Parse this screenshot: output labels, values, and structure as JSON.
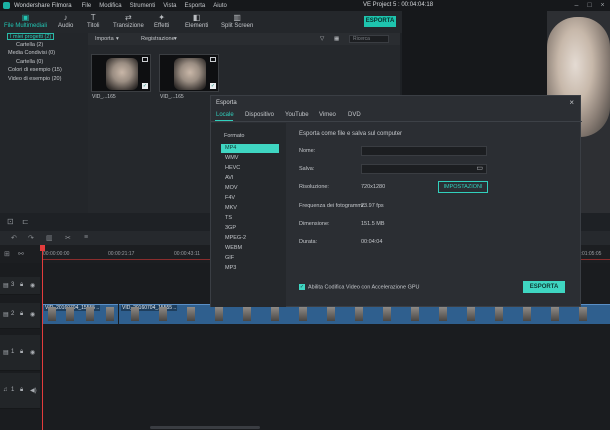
{
  "titlebar": {
    "app": "Wondershare Filmora",
    "menu": [
      "File",
      "Modifica",
      "Strumenti",
      "Vista",
      "Esporta",
      "Aiuto"
    ],
    "project": "VE Project 5 : 00:04:04:18"
  },
  "toolbar": {
    "tabs": [
      {
        "label": "File Multimediali",
        "icon": "folder-icon"
      },
      {
        "label": "Audio",
        "icon": "music-note-icon"
      },
      {
        "label": "Titoli",
        "icon": "text-icon"
      },
      {
        "label": "Transizione",
        "icon": "transition-icon"
      },
      {
        "label": "Effetti",
        "icon": "effects-icon"
      },
      {
        "label": "Elementi",
        "icon": "elements-icon"
      },
      {
        "label": "Split Screen",
        "icon": "split-screen-icon"
      }
    ],
    "export": "ESPORTA"
  },
  "sidebar": {
    "items": [
      "I miei progetti (2)",
      "Cartella (2)",
      "Media Condivisi (0)",
      "Cartella (0)",
      "Colori di esempio (15)",
      "Video di esempio (20)"
    ]
  },
  "media": {
    "import": "Importa",
    "record": "Registrazione",
    "search_placeholder": "Ricerca",
    "clips": [
      "VID_...165",
      "VID_...165"
    ]
  },
  "timeline": {
    "ticks": [
      "00:00:00:00",
      "00:00:21:17",
      "00:00:43:11",
      "00:01:05:05"
    ],
    "tracks": [
      "3",
      "2",
      "1",
      "1"
    ],
    "clip_labels": [
      "VID_20160704_15555 ..",
      "VID_20160704_15555 .."
    ]
  },
  "dialog": {
    "title": "Esporta",
    "tabs": [
      "Locale",
      "Dispositivo",
      "YouTube",
      "Vimeo",
      "DVD"
    ],
    "format_header": "Formato",
    "formats": [
      "MP4",
      "WMV",
      "HEVC",
      "AVI",
      "MOV",
      "F4V",
      "MKV",
      "TS",
      "3GP",
      "MPEG-2",
      "WEBM",
      "GIF",
      "MP3"
    ],
    "selected_format": "MP4",
    "heading": "Esporta come file e salva sul computer",
    "fields": {
      "name_label": "Nome:",
      "save_label": "Salva:",
      "resolution_label": "Risoluzione:",
      "resolution": "720x1280",
      "settings_button": "IMPOSTAZIONI",
      "framerate_label": "Frequenza dei fotogrammi:",
      "framerate": "23.97 fps",
      "size_label": "Dimensione:",
      "size": "151.5 MB",
      "duration_label": "Durata:",
      "duration": "00:04:04"
    },
    "gpu": "Abilita Codifica Video con Accelerazione GPU",
    "export_button": "ESPORTA"
  }
}
